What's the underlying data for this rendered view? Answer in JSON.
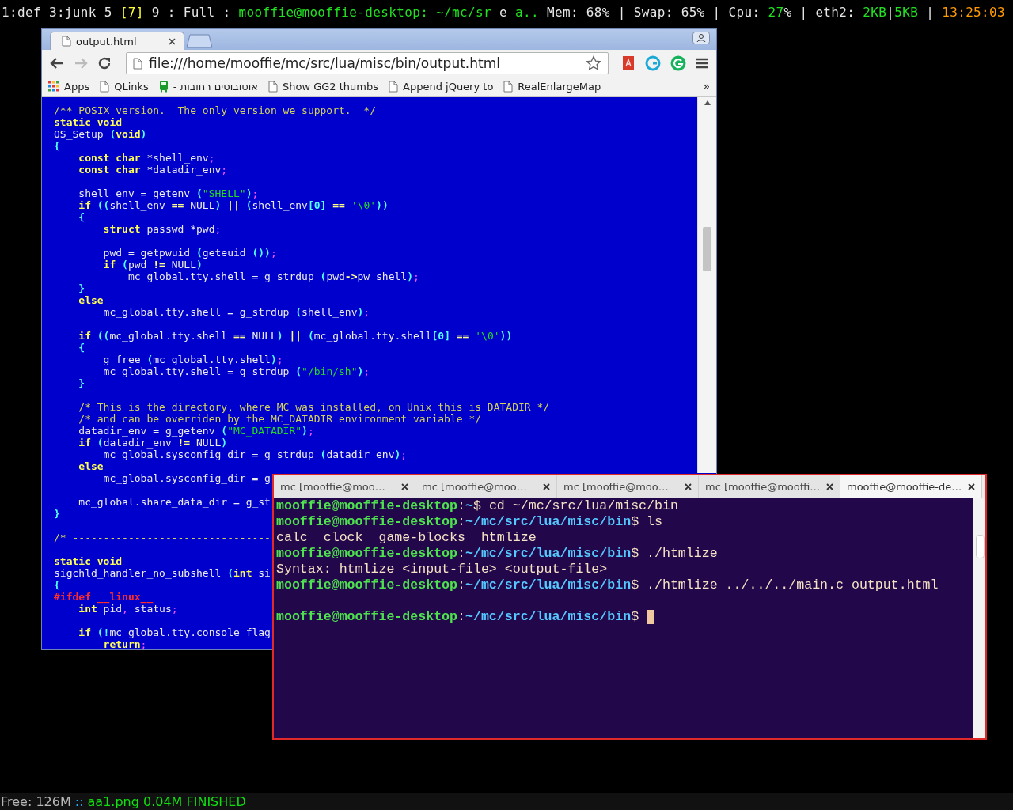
{
  "top_bar": {
    "groups": [
      [
        {
          "text": "1:def 3:junk 5",
          "kind": "plain"
        }
      ],
      [
        {
          "text": "[7]",
          "kind": "current"
        }
      ],
      [
        {
          "text": "9 : Full :",
          "kind": "plain"
        }
      ],
      [
        {
          "text": "mooffie@mooffie-desktop: ~/mc/sr",
          "kind": "accent"
        }
      ],
      [
        {
          "text": "e",
          "kind": "plain"
        }
      ],
      [
        {
          "text": "a..",
          "kind": "accent"
        }
      ],
      [
        {
          "text": "Mem: 68% | Swap: 65% | Cpu:",
          "kind": "plain"
        }
      ],
      [
        {
          "text": "27",
          "kind": "accent"
        },
        {
          "text": "% | eth2:",
          "kind": "plain"
        }
      ],
      [
        {
          "text": "2KB",
          "kind": "accent"
        },
        {
          "text": "|",
          "kind": "plain"
        },
        {
          "text": "5KB",
          "kind": "accent"
        }
      ],
      [
        {
          "text": "|",
          "kind": "plain"
        }
      ],
      [
        {
          "text": "13:25:03",
          "kind": "clock"
        }
      ]
    ]
  },
  "browser": {
    "tabs": [
      {
        "title": "output.html",
        "selected": true
      }
    ],
    "forward_disabled": true,
    "address": "file:///home/mooffie/mc/src/lua/misc/bin/output.html",
    "bookmarks": [
      {
        "label": "Apps",
        "kind": "apps"
      },
      {
        "label": "QLinks",
        "kind": "page"
      },
      {
        "label": "אוטובוסים רחובות -",
        "kind": "bus"
      },
      {
        "label": "Show GG2 thumbs",
        "kind": "page"
      },
      {
        "label": "Append jQuery to",
        "kind": "page"
      },
      {
        "label": "RealEnlargeMap",
        "kind": "page"
      }
    ],
    "bookmarks_more": "»",
    "code_blocks": [
      [
        [
          {
            "kind": "comment",
            "text": "/** POSIX version.  The only version we support.  */"
          }
        ],
        [
          {
            "kind": "keyword",
            "text": "static void"
          }
        ],
        [
          {
            "kind": "plain",
            "text": "OS_Setup "
          },
          {
            "kind": "punct",
            "text": "("
          },
          {
            "kind": "keyword",
            "text": "void"
          },
          {
            "kind": "punct",
            "text": ")"
          }
        ],
        [
          {
            "kind": "punct",
            "text": "{"
          }
        ],
        [
          {
            "kind": "keyword",
            "text": "    const char"
          },
          {
            "kind": "plain",
            "text": " *shell_env"
          },
          {
            "kind": "semi",
            "text": ";"
          }
        ],
        [
          {
            "kind": "keyword",
            "text": "    const char"
          },
          {
            "kind": "plain",
            "text": " *datadir_env"
          },
          {
            "kind": "semi",
            "text": ";"
          }
        ]
      ],
      [
        [
          {
            "kind": "plain",
            "text": "    shell_env = getenv "
          },
          {
            "kind": "punct",
            "text": "("
          },
          {
            "kind": "string",
            "text": "\"SHELL\""
          },
          {
            "kind": "punct",
            "text": ")"
          },
          {
            "kind": "semi",
            "text": ";"
          }
        ],
        [
          {
            "kind": "keyword",
            "text": "    if "
          },
          {
            "kind": "punct",
            "text": "(("
          },
          {
            "kind": "plain",
            "text": "shell_env "
          },
          {
            "kind": "op",
            "text": "=="
          },
          {
            "kind": "plain",
            "text": " NULL"
          },
          {
            "kind": "punct",
            "text": ") "
          },
          {
            "kind": "op",
            "text": "||"
          },
          {
            "kind": "punct",
            "text": " ("
          },
          {
            "kind": "plain",
            "text": "shell_env"
          },
          {
            "kind": "punct",
            "text": "[0]"
          },
          {
            "kind": "op",
            "text": " == "
          },
          {
            "kind": "string",
            "text": "'\\0'"
          },
          {
            "kind": "punct",
            "text": "))"
          }
        ],
        [
          {
            "kind": "punct",
            "text": "    {"
          }
        ],
        [
          {
            "kind": "keyword",
            "text": "        struct"
          },
          {
            "kind": "plain",
            "text": " passwd *pwd"
          },
          {
            "kind": "semi",
            "text": ";"
          }
        ]
      ],
      [
        [
          {
            "kind": "plain",
            "text": "        pwd = getpwuid "
          },
          {
            "kind": "punct",
            "text": "("
          },
          {
            "kind": "plain",
            "text": "geteuid "
          },
          {
            "kind": "punct",
            "text": "())"
          },
          {
            "kind": "semi",
            "text": ";"
          }
        ],
        [
          {
            "kind": "keyword",
            "text": "        if "
          },
          {
            "kind": "punct",
            "text": "("
          },
          {
            "kind": "plain",
            "text": "pwd "
          },
          {
            "kind": "op",
            "text": "!="
          },
          {
            "kind": "plain",
            "text": " NULL"
          },
          {
            "kind": "punct",
            "text": ")"
          }
        ],
        [
          {
            "kind": "plain",
            "text": "            mc_global.tty.shell = g_strdup "
          },
          {
            "kind": "punct",
            "text": "("
          },
          {
            "kind": "plain",
            "text": "pwd"
          },
          {
            "kind": "op",
            "text": "->"
          },
          {
            "kind": "plain",
            "text": "pw_shell"
          },
          {
            "kind": "punct",
            "text": ")"
          },
          {
            "kind": "semi",
            "text": ";"
          }
        ],
        [
          {
            "kind": "punct",
            "text": "    }"
          }
        ],
        [
          {
            "kind": "keyword",
            "text": "    else"
          }
        ],
        [
          {
            "kind": "plain",
            "text": "        mc_global.tty.shell = g_strdup "
          },
          {
            "kind": "punct",
            "text": "("
          },
          {
            "kind": "plain",
            "text": "shell_env"
          },
          {
            "kind": "punct",
            "text": ")"
          },
          {
            "kind": "semi",
            "text": ";"
          }
        ]
      ],
      [
        [
          {
            "kind": "keyword",
            "text": "    if "
          },
          {
            "kind": "punct",
            "text": "(("
          },
          {
            "kind": "plain",
            "text": "mc_global.tty.shell "
          },
          {
            "kind": "op",
            "text": "=="
          },
          {
            "kind": "plain",
            "text": " NULL"
          },
          {
            "kind": "punct",
            "text": ") "
          },
          {
            "kind": "op",
            "text": "||"
          },
          {
            "kind": "punct",
            "text": " ("
          },
          {
            "kind": "plain",
            "text": "mc_global.tty.shell"
          },
          {
            "kind": "punct",
            "text": "[0]"
          },
          {
            "kind": "op",
            "text": " == "
          },
          {
            "kind": "string",
            "text": "'\\0'"
          },
          {
            "kind": "punct",
            "text": "))"
          }
        ],
        [
          {
            "kind": "punct",
            "text": "    {"
          }
        ],
        [
          {
            "kind": "plain",
            "text": "        g_free "
          },
          {
            "kind": "punct",
            "text": "("
          },
          {
            "kind": "plain",
            "text": "mc_global.tty.shell"
          },
          {
            "kind": "punct",
            "text": ")"
          },
          {
            "kind": "semi",
            "text": ";"
          }
        ],
        [
          {
            "kind": "plain",
            "text": "        mc_global.tty.shell = g_strdup "
          },
          {
            "kind": "punct",
            "text": "("
          },
          {
            "kind": "string",
            "text": "\"/bin/sh\""
          },
          {
            "kind": "punct",
            "text": ")"
          },
          {
            "kind": "semi",
            "text": ";"
          }
        ],
        [
          {
            "kind": "punct",
            "text": "    }"
          }
        ]
      ],
      [
        [
          {
            "kind": "comment",
            "text": "    /* This is the directory, where MC was installed, on Unix this is DATADIR */"
          }
        ],
        [
          {
            "kind": "comment",
            "text": "    /* and can be overriden by the MC_DATADIR environment variable */"
          }
        ],
        [
          {
            "kind": "plain",
            "text": "    datadir_env = g_getenv "
          },
          {
            "kind": "punct",
            "text": "("
          },
          {
            "kind": "string",
            "text": "\"MC_DATADIR\""
          },
          {
            "kind": "punct",
            "text": ")"
          },
          {
            "kind": "semi",
            "text": ";"
          }
        ],
        [
          {
            "kind": "keyword",
            "text": "    if "
          },
          {
            "kind": "punct",
            "text": "("
          },
          {
            "kind": "plain",
            "text": "datadir_env "
          },
          {
            "kind": "op",
            "text": "!="
          },
          {
            "kind": "plain",
            "text": " NULL"
          },
          {
            "kind": "punct",
            "text": ")"
          }
        ],
        [
          {
            "kind": "plain",
            "text": "        mc_global.sysconfig_dir = g_strdup "
          },
          {
            "kind": "punct",
            "text": "("
          },
          {
            "kind": "plain",
            "text": "datadir_env"
          },
          {
            "kind": "punct",
            "text": ")"
          },
          {
            "kind": "semi",
            "text": ";"
          }
        ],
        [
          {
            "kind": "keyword",
            "text": "    else"
          }
        ],
        [
          {
            "kind": "plain",
            "text": "        mc_global.sysconfig_dir = g"
          }
        ]
      ],
      [
        [
          {
            "kind": "plain",
            "text": "    mc_global.share_data_dir = g_st"
          }
        ],
        [
          {
            "kind": "punct",
            "text": "}"
          }
        ]
      ],
      [
        [
          {
            "kind": "comment",
            "text": "/* --------------------------------"
          }
        ]
      ],
      [
        [
          {
            "kind": "keyword",
            "text": "static void"
          }
        ],
        [
          {
            "kind": "plain",
            "text": "sigchld_handler_no_subshell "
          },
          {
            "kind": "punct",
            "text": "("
          },
          {
            "kind": "keyword",
            "text": "int"
          },
          {
            "kind": "plain",
            "text": " si"
          }
        ],
        [
          {
            "kind": "punct",
            "text": "{"
          }
        ],
        [
          {
            "kind": "preproc",
            "text": "#ifdef __linux__"
          }
        ],
        [
          {
            "kind": "keyword",
            "text": "    int"
          },
          {
            "kind": "plain",
            "text": " pid"
          },
          {
            "kind": "semi",
            "text": ","
          },
          {
            "kind": "plain",
            "text": " status"
          },
          {
            "kind": "semi",
            "text": ";"
          }
        ]
      ],
      [
        [
          {
            "kind": "keyword",
            "text": "    if "
          },
          {
            "kind": "punct",
            "text": "(!"
          },
          {
            "kind": "plain",
            "text": "mc_global.tty.console_flag"
          }
        ],
        [
          {
            "kind": "keyword",
            "text": "        return"
          },
          {
            "kind": "semi",
            "text": ";"
          }
        ]
      ]
    ]
  },
  "terminal": {
    "tabs": [
      {
        "title": "mc [mooffie@moo…",
        "selected": false
      },
      {
        "title": "mc [mooffie@moo…",
        "selected": false
      },
      {
        "title": "mc [mooffie@moo…",
        "selected": false
      },
      {
        "title": "mc [mooffie@mooffi…",
        "selected": false
      },
      {
        "title": "mooffie@mooffie-de…",
        "selected": true
      }
    ],
    "blocks": [
      [
        [
          {
            "kind": "user",
            "text": "mooffie@mooffie-desktop"
          },
          {
            "kind": "text",
            "text": ":"
          },
          {
            "kind": "path",
            "text": "~"
          },
          {
            "kind": "text",
            "text": "$ cd ~/mc/src/lua/misc/bin"
          }
        ],
        [
          {
            "kind": "user",
            "text": "mooffie@mooffie-desktop"
          },
          {
            "kind": "text",
            "text": ":"
          },
          {
            "kind": "path",
            "text": "~/mc/src/lua/misc/bin"
          },
          {
            "kind": "text",
            "text": "$ ls"
          }
        ],
        [
          {
            "kind": "text",
            "text": "calc  clock  game-blocks  htmlize"
          }
        ],
        [
          {
            "kind": "user",
            "text": "mooffie@mooffie-desktop"
          },
          {
            "kind": "text",
            "text": ":"
          },
          {
            "kind": "path",
            "text": "~/mc/src/lua/misc/bin"
          },
          {
            "kind": "text",
            "text": "$ ./htmlize"
          }
        ],
        [
          {
            "kind": "text",
            "text": "Syntax: htmlize <input-file> <output-file>"
          }
        ],
        [
          {
            "kind": "user",
            "text": "mooffie@mooffie-desktop"
          },
          {
            "kind": "text",
            "text": ":"
          },
          {
            "kind": "path",
            "text": "~/mc/src/lua/misc/bin"
          },
          {
            "kind": "text",
            "text": "$ ./htmlize ../../../main.c output.html"
          }
        ]
      ],
      [
        [
          {
            "kind": "user",
            "text": "mooffie@mooffie-desktop"
          },
          {
            "kind": "text",
            "text": ":"
          },
          {
            "kind": "path",
            "text": "~/mc/src/lua/misc/bin"
          },
          {
            "kind": "text",
            "text": "$"
          }
        ]
      ]
    ],
    "cursor": true
  },
  "bottom_bar": {
    "segments": [
      {
        "text": "Free: 126M",
        "kind": "plain"
      },
      {
        "text": "::",
        "kind": "sep"
      },
      {
        "text": "aa1.png 0.04M FINISHED",
        "kind": "accent"
      }
    ]
  }
}
